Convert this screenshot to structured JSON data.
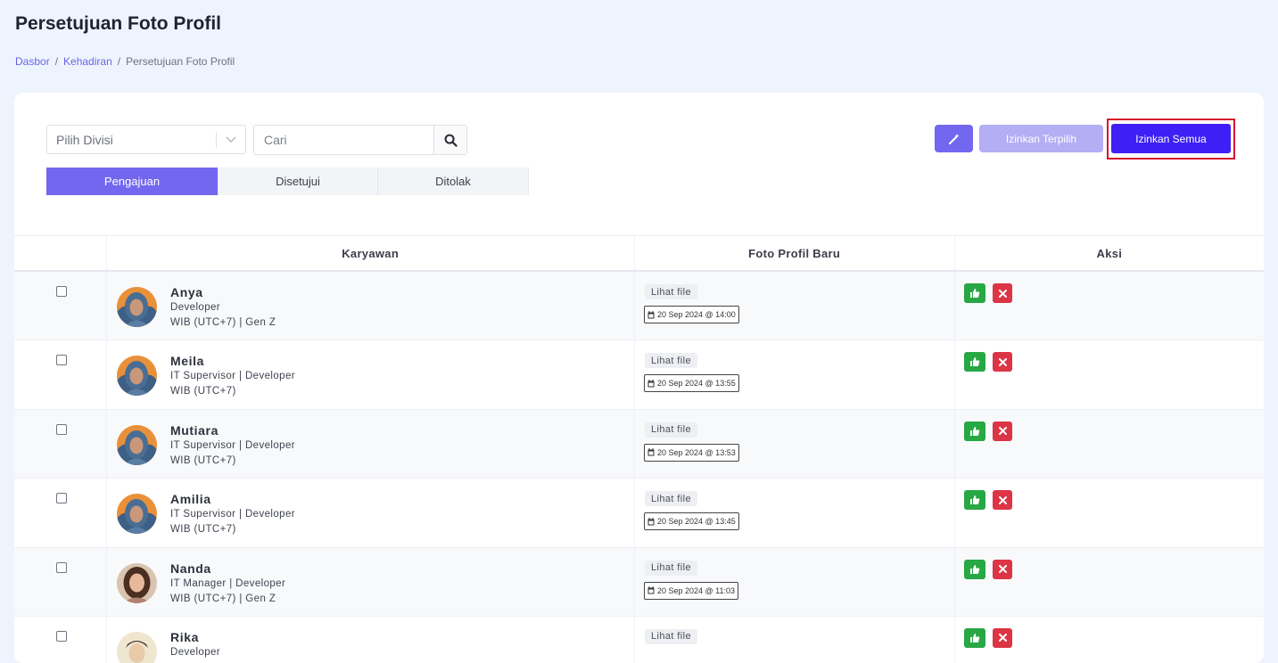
{
  "header": {
    "title": "Persetujuan Foto Profil",
    "breadcrumb": [
      {
        "label": "Dasbor"
      },
      {
        "label": "Kehadiran"
      },
      {
        "label": "Persetujuan Foto Profil"
      }
    ],
    "breadcrumb_separator": "/"
  },
  "filters": {
    "division_select": "Pilih Divisi",
    "search_placeholder": "Cari"
  },
  "tabs": [
    {
      "label": "Pengajuan",
      "active": true
    },
    {
      "label": "Disetujui",
      "active": false
    },
    {
      "label": "Ditolak",
      "active": false
    }
  ],
  "actions": {
    "magic_icon": "magic-wand-icon",
    "approve_selected": "Izinkan Terpilih",
    "approve_all": "Izinkan Semua"
  },
  "table": {
    "columns": [
      "Karyawan",
      "Foto Profil Baru",
      "Aksi"
    ],
    "rows": [
      {
        "name": "Anya",
        "line1": "Developer",
        "line2": "WIB (UTC+7) | Gen Z",
        "file_label": "Lihat file",
        "date": "20 Sep 2024 @ 14:00",
        "avatar": "hijab"
      },
      {
        "name": "Meila",
        "line1": "IT Supervisor | Developer",
        "line2": "WIB (UTC+7)",
        "file_label": "Lihat file",
        "date": "20 Sep 2024 @ 13:55",
        "avatar": "hijab"
      },
      {
        "name": "Mutiara",
        "line1": "IT Supervisor | Developer",
        "line2": "WIB (UTC+7)",
        "file_label": "Lihat file",
        "date": "20 Sep 2024 @ 13:53",
        "avatar": "hijab"
      },
      {
        "name": "Amilia",
        "line1": "IT Supervisor | Developer",
        "line2": "WIB (UTC+7)",
        "file_label": "Lihat file",
        "date": "20 Sep 2024 @ 13:45",
        "avatar": "hijab"
      },
      {
        "name": "Nanda",
        "line1": "IT Manager | Developer",
        "line2": "WIB (UTC+7) | Gen Z",
        "file_label": "Lihat file",
        "date": "20 Sep 2024 @ 11:03",
        "avatar": "hair"
      },
      {
        "name": "Rika",
        "line1": "Developer",
        "line2": "",
        "file_label": "Lihat file",
        "date": "",
        "avatar": "light"
      }
    ]
  },
  "icons": {
    "search": "search-icon",
    "approve": "thumbs-up-icon",
    "reject": "close-icon",
    "date": "calendar-icon"
  },
  "colors": {
    "primary": "#7367f0",
    "approve_all": "#3f1ff5",
    "highlight": "#d4142c",
    "approve": "#28a745",
    "reject": "#dc3545"
  }
}
